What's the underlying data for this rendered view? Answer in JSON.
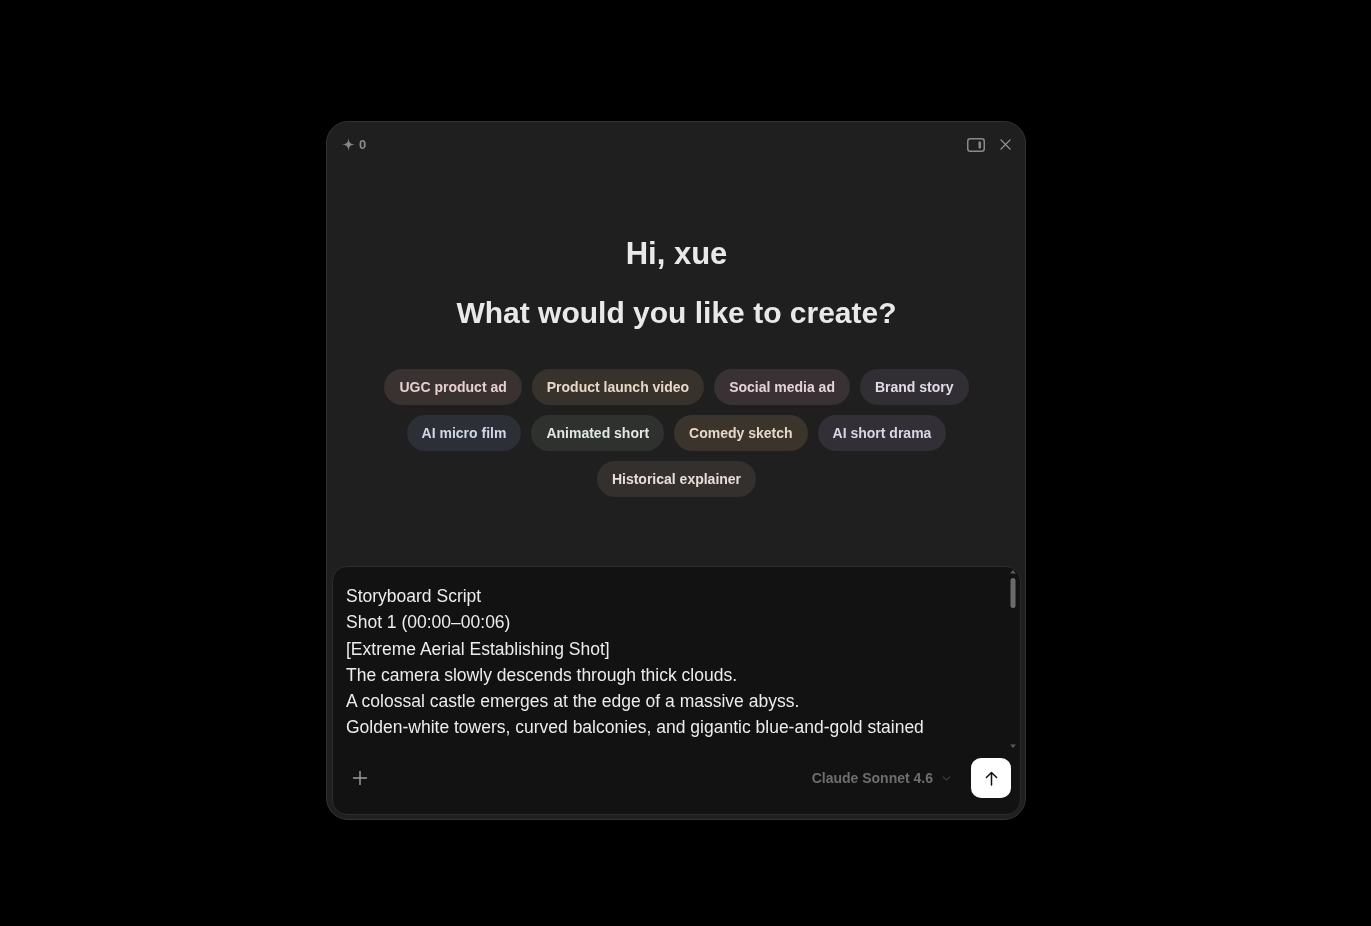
{
  "header": {
    "credits": "0"
  },
  "greeting": "Hi, xue",
  "heading": "What would you like to create?",
  "suggestions": [
    {
      "label": "UGC product ad",
      "color": "#3a3131"
    },
    {
      "label": "Product launch video",
      "color": "#38322c"
    },
    {
      "label": "Social media ad",
      "color": "#393133"
    },
    {
      "label": "Brand story",
      "color": "#322f34"
    },
    {
      "label": "AI micro film",
      "color": "#2c2f35"
    },
    {
      "label": "Animated short",
      "color": "#2e312e"
    },
    {
      "label": "Comedy sketch",
      "color": "#3a342d"
    },
    {
      "label": "AI short drama",
      "color": "#322f36"
    },
    {
      "label": "Historical explainer",
      "color": "#34302e"
    }
  ],
  "composer": {
    "value": "Storyboard Script\nShot 1 (00:00–00:06)\n[Extreme Aerial Establishing Shot]\nThe camera slowly descends through thick clouds.\nA colossal castle emerges at the edge of a massive abyss.\nGolden-white towers, curved balconies, and gigantic blue-and-gold stained",
    "model": "Claude Sonnet 4.6"
  }
}
